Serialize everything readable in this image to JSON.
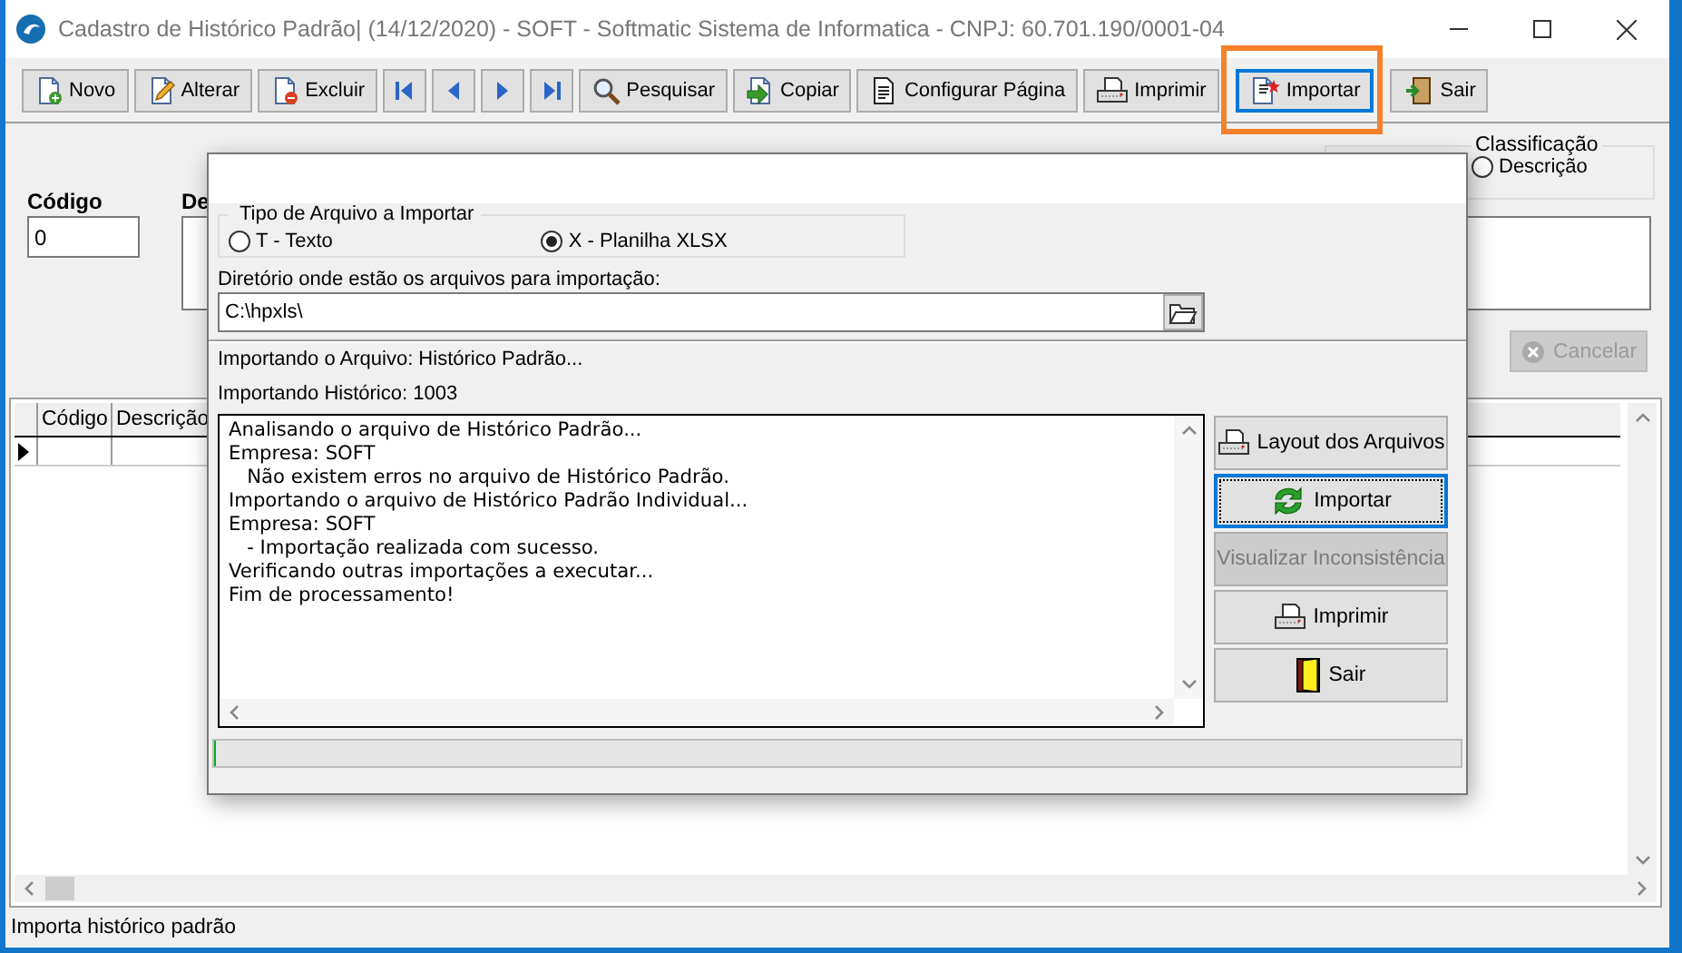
{
  "window": {
    "title": "Cadastro de Histórico Padrão| (14/12/2020) - SOFT - Softmatic Sistema de Informatica  - CNPJ: 60.701.190/0001-04"
  },
  "toolbar": [
    {
      "kind": "command",
      "label": "Novo",
      "focused": false,
      "highlighted": false
    },
    {
      "kind": "command",
      "label": "Alterar",
      "focused": false,
      "highlighted": false
    },
    {
      "kind": "command",
      "label": "Excluir",
      "focused": false,
      "highlighted": false
    },
    {
      "kind": "first"
    },
    {
      "kind": "previous"
    },
    {
      "kind": "next"
    },
    {
      "kind": "last"
    },
    {
      "kind": "command",
      "label": "Pesquisar",
      "focused": false,
      "highlighted": false
    },
    {
      "kind": "command",
      "label": "Copiar",
      "focused": false,
      "highlighted": false
    },
    {
      "kind": "command",
      "label": "Configurar Página",
      "focused": false,
      "highlighted": false
    },
    {
      "kind": "command",
      "label": "Imprimir",
      "focused": false,
      "highlighted": false
    },
    {
      "kind": "command",
      "label": "Importar",
      "focused": true,
      "highlighted": true
    },
    {
      "kind": "command",
      "label": "Sair",
      "focused": false,
      "highlighted": false
    }
  ],
  "form": {
    "code": {
      "label": "Código",
      "value": "0"
    },
    "description": {
      "label": "De"
    },
    "classification": {
      "label": "Classificação",
      "options": [
        {
          "label": "Descrição",
          "selected": false
        }
      ]
    },
    "cancel_button": {
      "label": "Cancelar",
      "disabled": true
    }
  },
  "grid": {
    "columns": [
      "Código",
      "Descrição"
    ],
    "rows": [
      {
        "current": true
      }
    ]
  },
  "status_bar": "Importa histórico padrão",
  "dialog": {
    "file_type": {
      "label": "Tipo de Arquivo a Importar",
      "options": [
        {
          "label": "T - Texto",
          "selected": false
        },
        {
          "label": "X - Planilha XLSX",
          "selected": true
        }
      ]
    },
    "directory": {
      "label": "Diretório onde estão os arquivos para importação:",
      "value": "C:\\hpxls\\"
    },
    "status_lines": [
      "Importando o Arquivo: Histórico Padrão...",
      "Importando Histórico: 1003"
    ],
    "log": [
      "Analisando o arquivo de Histórico Padrão...",
      "Empresa: SOFT",
      "   Não existem erros no arquivo de Histórico Padrão.",
      "Importando o arquivo de Histórico Padrão Individual...",
      "Empresa: SOFT",
      "   - Importação realizada com sucesso.",
      "Verificando outras importações a executar...",
      "Fim de processamento!"
    ],
    "buttons": [
      {
        "label": "Layout dos Arquivos",
        "focused": false,
        "disabled": false
      },
      {
        "label": "Importar",
        "focused": true,
        "disabled": false
      },
      {
        "label": "Visualizar Inconsistência",
        "focused": false,
        "disabled": true
      },
      {
        "label": "Imprimir",
        "focused": false,
        "disabled": false
      },
      {
        "label": "Sair",
        "focused": false,
        "disabled": false
      }
    ],
    "progress": {
      "level": 0
    }
  }
}
